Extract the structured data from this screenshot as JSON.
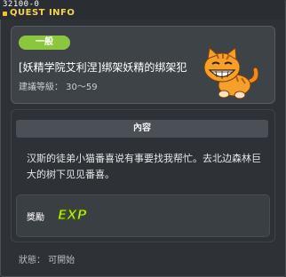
{
  "window": {
    "quest_id": "32100-0",
    "title": "QUEST INFO"
  },
  "quest": {
    "category": "一般",
    "name": "[妖精学院艾利涅]绑架妖精的绑架犯",
    "level": "建議等級： 30～59",
    "npc_icon": "orange-cat-icon"
  },
  "content": {
    "header": "內容",
    "description": "汉斯的徒弟小猫番喜说有事要找我帮忙。去北边森林巨大的树下见见番喜。"
  },
  "reward": {
    "label": "獎勵",
    "exp_label": "EXP"
  },
  "status": {
    "text": "狀態： 可開始"
  },
  "colors": {
    "accent_title": "#f6d54a",
    "badge": "#8cc63e",
    "exp": "#b6e82e"
  }
}
